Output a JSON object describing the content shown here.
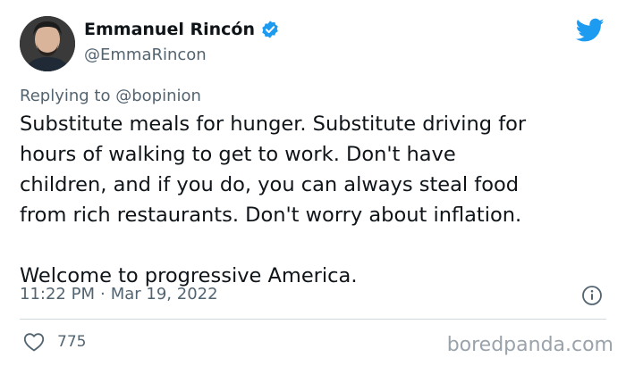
{
  "author": {
    "display_name": "Emmanuel Rincón",
    "handle": "@EmmaRincon",
    "verified": true
  },
  "reply_context": "Replying to @bopinion",
  "body": {
    "lines": [
      "Substitute meals for hunger. Substitute driving for",
      "hours of walking to get to work. Don't have",
      "children, and if you do, you can always steal food",
      "from rich restaurants. Don't worry about inflation."
    ],
    "closing": "Welcome to progressive America."
  },
  "meta": {
    "time": "11:22 PM",
    "separator": "·",
    "date": "Mar 19, 2022"
  },
  "stats": {
    "likes": "775"
  },
  "watermark": "boredpanda.com",
  "icons": {
    "platform": "bird-icon",
    "verified": "verified-badge-icon",
    "info": "info-icon",
    "like": "heart-icon"
  },
  "colors": {
    "brand": "#1d9bf0",
    "text": "#0f1419",
    "secondary": "#536471",
    "divider": "#cfd9de",
    "watermark": "#9aa3ab"
  }
}
